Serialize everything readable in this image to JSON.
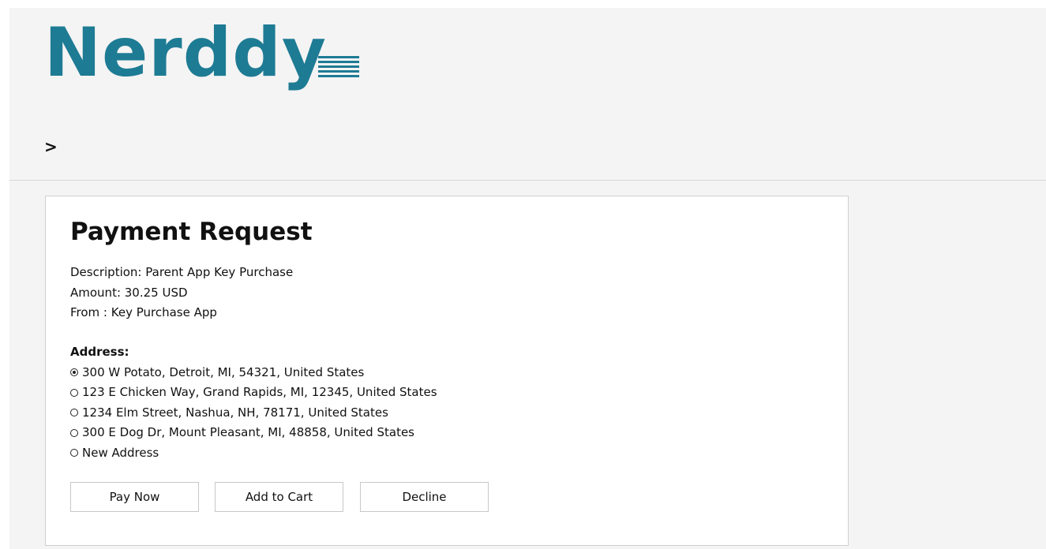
{
  "header": {
    "logo_text": "Nerddy",
    "menu_icon": "hamburger-icon",
    "breadcrumb": ">"
  },
  "colors": {
    "brand": "#1e7b94",
    "background": "#f4f4f5",
    "card": "#ffffff"
  },
  "payment": {
    "title": "Payment Request",
    "description": "Description: Parent App Key Purchase",
    "amount": "Amount: 30.25 USD",
    "from": "From : Key Purchase App",
    "address_label": "Address:",
    "addresses": [
      {
        "text": "300 W Potato, Detroit, MI, 54321, United States",
        "selected": true
      },
      {
        "text": "123 E Chicken Way, Grand Rapids, MI, 12345, United States",
        "selected": false
      },
      {
        "text": "1234 Elm Street, Nashua, NH, 78171, United States",
        "selected": false
      },
      {
        "text": "300 E Dog Dr, Mount Pleasant, MI, 48858, United States",
        "selected": false
      },
      {
        "text": "New Address",
        "selected": false
      }
    ],
    "buttons": {
      "pay_now": "Pay Now",
      "add_to_cart": "Add to Cart",
      "decline": "Decline"
    }
  }
}
